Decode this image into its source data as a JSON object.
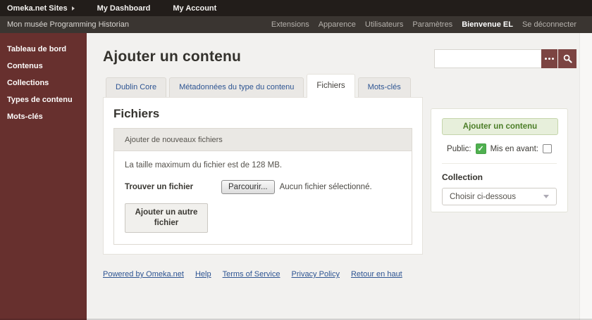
{
  "topbar": {
    "brand": "Omeka.net Sites",
    "links": [
      "My Dashboard",
      "My Account"
    ]
  },
  "adminbar": {
    "site_title": "Mon musée Programming Historian",
    "nav": [
      "Extensions",
      "Apparence",
      "Utilisateurs",
      "Paramètres"
    ],
    "welcome": "Bienvenue EL",
    "logout": "Se déconnecter"
  },
  "sidebar": {
    "items": [
      "Tableau de bord",
      "Contenus",
      "Collections",
      "Types de contenu",
      "Mots-clés"
    ]
  },
  "page": {
    "title": "Ajouter un contenu",
    "search": {
      "value": "",
      "placeholder": ""
    },
    "tabs": [
      "Dublin Core",
      "Métadonnées du type du contenu",
      "Fichiers",
      "Mots-clés"
    ],
    "active_tab": "Fichiers"
  },
  "files_panel": {
    "heading": "Fichiers",
    "fieldset_title": "Ajouter de nouveaux fichiers",
    "max_size_note": "La taille maximum du fichier est de 128 MB.",
    "find_file_label": "Trouver un fichier",
    "browse_button": "Parcourir...",
    "no_file_text": "Aucun fichier sélectionné.",
    "add_another_button": "Ajouter un autre fichier"
  },
  "save_panel": {
    "submit_button": "Ajouter un contenu",
    "public_label": "Public:",
    "public_checked": true,
    "featured_label": "Mis en avant:",
    "featured_checked": false,
    "collection_label": "Collection",
    "collection_selected": "Choisir ci-dessous"
  },
  "footer": {
    "links": [
      "Powered by Omeka.net",
      "Help",
      "Terms of Service",
      "Privacy Policy",
      "Retour en haut"
    ]
  },
  "colors": {
    "sidebar_maroon": "#67302e",
    "button_maroon": "#7c4442",
    "link_blue": "#2d5492",
    "green_accent": "#4c7e28",
    "checkbox_green": "#4fb050"
  }
}
